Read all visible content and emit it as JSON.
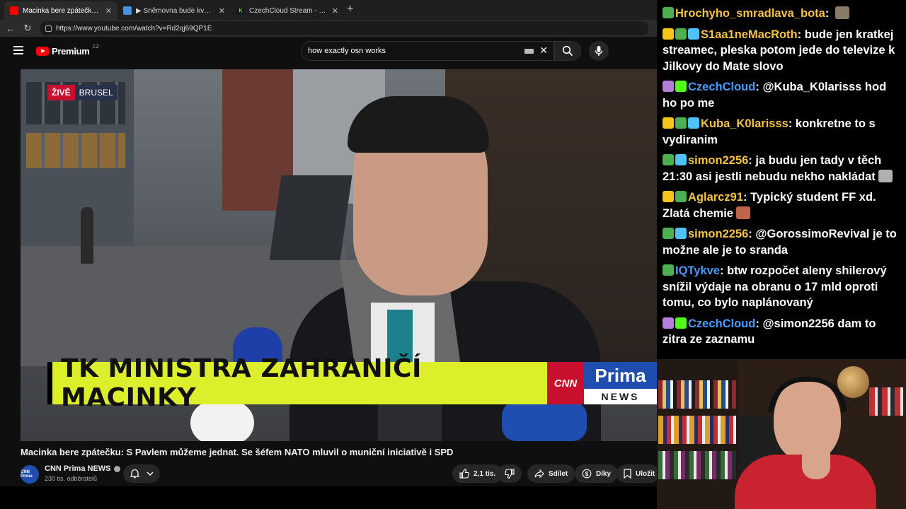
{
  "browser": {
    "tabs": [
      {
        "title": "Macinka bere zpátečku: S Pavlem mů",
        "favicon_color": "#ff0000",
        "active": true
      },
      {
        "title": "▶ Sněmovna bude kvůli Macinkov",
        "favicon_color": "#4a90e2",
        "active": false
      },
      {
        "title": "CzechCloud Stream - Watch Live o",
        "favicon_color": "#53fc18",
        "active": false
      }
    ],
    "new_tab": "+",
    "url": "https://www.youtube.com/watch?v=Rd2qj69QP1E"
  },
  "youtube": {
    "logo_word": "Premium",
    "logo_region": "CZ",
    "search_value": "how exactly osn works",
    "video": {
      "live_label": "ŽIVĚ",
      "location_label": "BRUSEL",
      "lower_third": "TK MINISTRA ZAHRANIČÍ MACINKY",
      "logo_cnn": "CNN",
      "logo_prima": "Prima",
      "logo_news": "NEWS"
    },
    "title": "Macinka bere zpátečku: S Pavlem můžeme jednat. Se šéfem NATO mluvil o muniční iniciativě i SPD",
    "channel": {
      "name": "CNN Prima NEWS",
      "avatar_text": "CNN Prima",
      "subscribers": "230 tis. odběratelů"
    },
    "actions": {
      "likes": "2,1 tis.",
      "share": "Sdílet",
      "thanks": "Díky",
      "save": "Uložit"
    }
  },
  "chat": [
    {
      "user": "Hrochyho_smradlava_bota",
      "color": "#f5c34a",
      "badges": [
        "#4caf50"
      ],
      "text": "",
      "emote": "#8a7a6a"
    },
    {
      "user": "S1aa1neMacRoth",
      "color": "#f5c34a",
      "badges": [
        "#f5c518",
        "#4caf50",
        "#4fc3f7"
      ],
      "text": "bude jen kratkej streamec, pleska potom jede do televize k Jilkovy do Mate slovo"
    },
    {
      "user": "CzechCloud",
      "color": "#4a9bff",
      "badges": [
        "#b57edc",
        "#53fc18"
      ],
      "text": "@Kuba_K0larisss hod ho po me"
    },
    {
      "user": "Kuba_K0larisss",
      "color": "#f5c34a",
      "badges": [
        "#f5c518",
        "#4caf50",
        "#4fc3f7"
      ],
      "text": "konkretne to s vydiranim"
    },
    {
      "user": "simon2256",
      "color": "#f5c34a",
      "badges": [
        "#4caf50",
        "#4fc3f7"
      ],
      "text": "ja budu jen tady v těch 21:30 asi jestli nebudu nekho nakládat",
      "emote": "#b0b0b0"
    },
    {
      "user": "Aglarcz91",
      "color": "#f5c34a",
      "badges": [
        "#f5c518",
        "#4caf50"
      ],
      "text": "Typický student FF xd. Zlatá chemie",
      "emote": "#c0654a"
    },
    {
      "user": "simon2256",
      "color": "#f5c34a",
      "badges": [
        "#4caf50",
        "#4fc3f7"
      ],
      "text": "@GorossimoRevival je to možne ale je to sranda"
    },
    {
      "user": "IQTykve",
      "color": "#4a9bff",
      "badges": [
        "#4caf50"
      ],
      "text": "btw rozpočet aleny shilerový snížil výdaje na obranu o 17 mld oproti tomu, co bylo naplánovaný"
    },
    {
      "user": "CzechCloud",
      "color": "#4a9bff",
      "badges": [
        "#b57edc",
        "#53fc18"
      ],
      "text": "@simon2256 dam to zitra ze zaznamu"
    }
  ]
}
